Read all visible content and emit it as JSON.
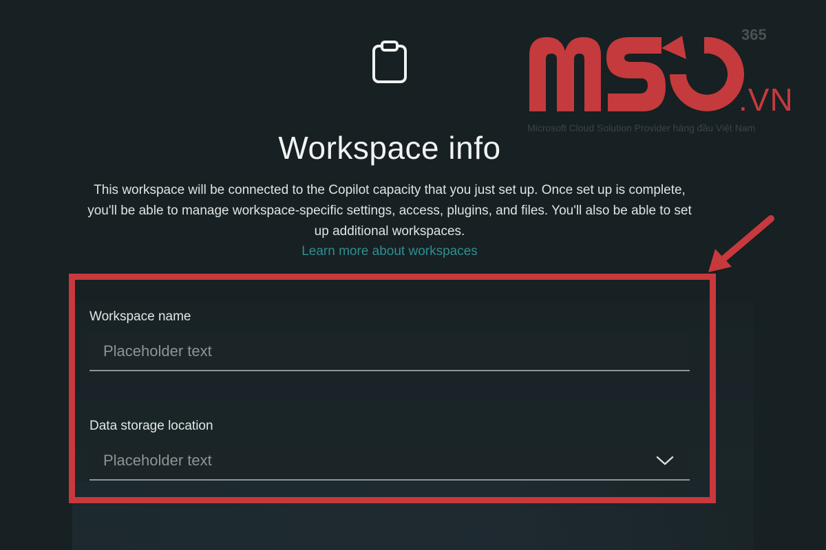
{
  "header": {
    "title": "Workspace info",
    "description": "This workspace will be connected to the Copilot capacity that you just set up. Once set up is complete, you'll be able to manage workspace-specific settings, access, plugins, and files. You'll also be able to set up additional workspaces.",
    "learn_more_link": "Learn more about workspaces",
    "icon": "clipboard-icon"
  },
  "form": {
    "workspace_name": {
      "label": "Workspace name",
      "placeholder": "Placeholder text"
    },
    "data_storage_location": {
      "label": "Data storage location",
      "placeholder": "Placeholder text",
      "icon": "chevron-down-icon"
    }
  },
  "watermark": {
    "brand": "MSO",
    "superscript": "365",
    "suffix": ".VN",
    "tagline": "Microsoft Cloud Solution Provider hàng đầu Việt Nam"
  },
  "colors": {
    "background": "#172022",
    "link": "#2f8e93",
    "highlight": "#c8393d",
    "brand": "#c43a3d"
  }
}
